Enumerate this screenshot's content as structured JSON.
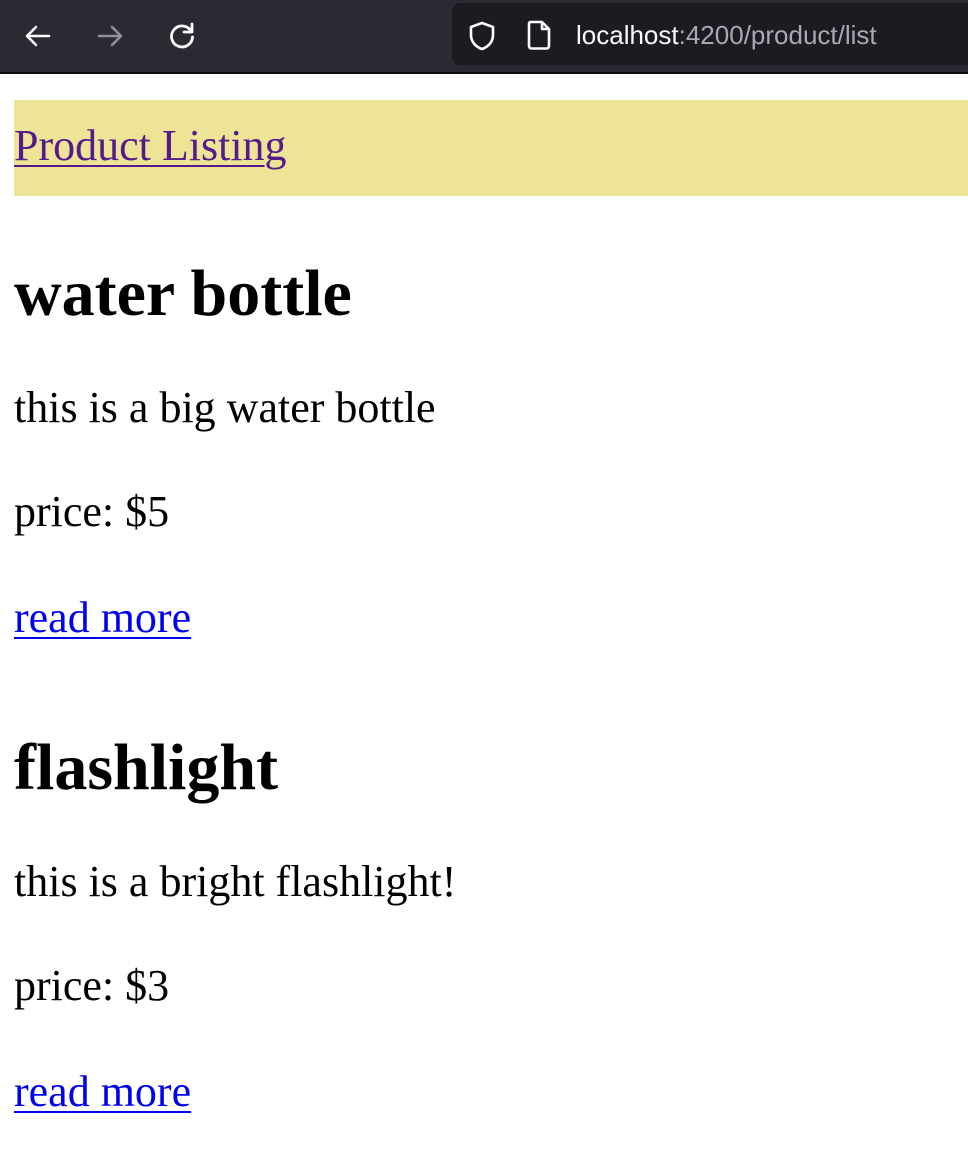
{
  "browser": {
    "url_host": "localhost",
    "url_rest": ":4200/product/list",
    "icons": {
      "back": "arrow-left-icon",
      "forward": "arrow-right-icon",
      "reload": "reload-icon",
      "tracking_protection": "shield-icon",
      "page_info": "page-icon"
    },
    "forward_enabled": false
  },
  "header": {
    "title_link": "Product Listing",
    "background_color": "#eee496",
    "link_color": "#551a8b"
  },
  "products": [
    {
      "name": "water bottle",
      "description": "this is a big water bottle",
      "price": "price: $5",
      "link": "read more"
    },
    {
      "name": "flashlight",
      "description": "this is a bright flashlight!",
      "price": "price: $3",
      "link": "read more"
    }
  ],
  "colors": {
    "link": "#0000ee",
    "toolbar": "#2b2a33",
    "urlbar": "#1c1b22"
  }
}
